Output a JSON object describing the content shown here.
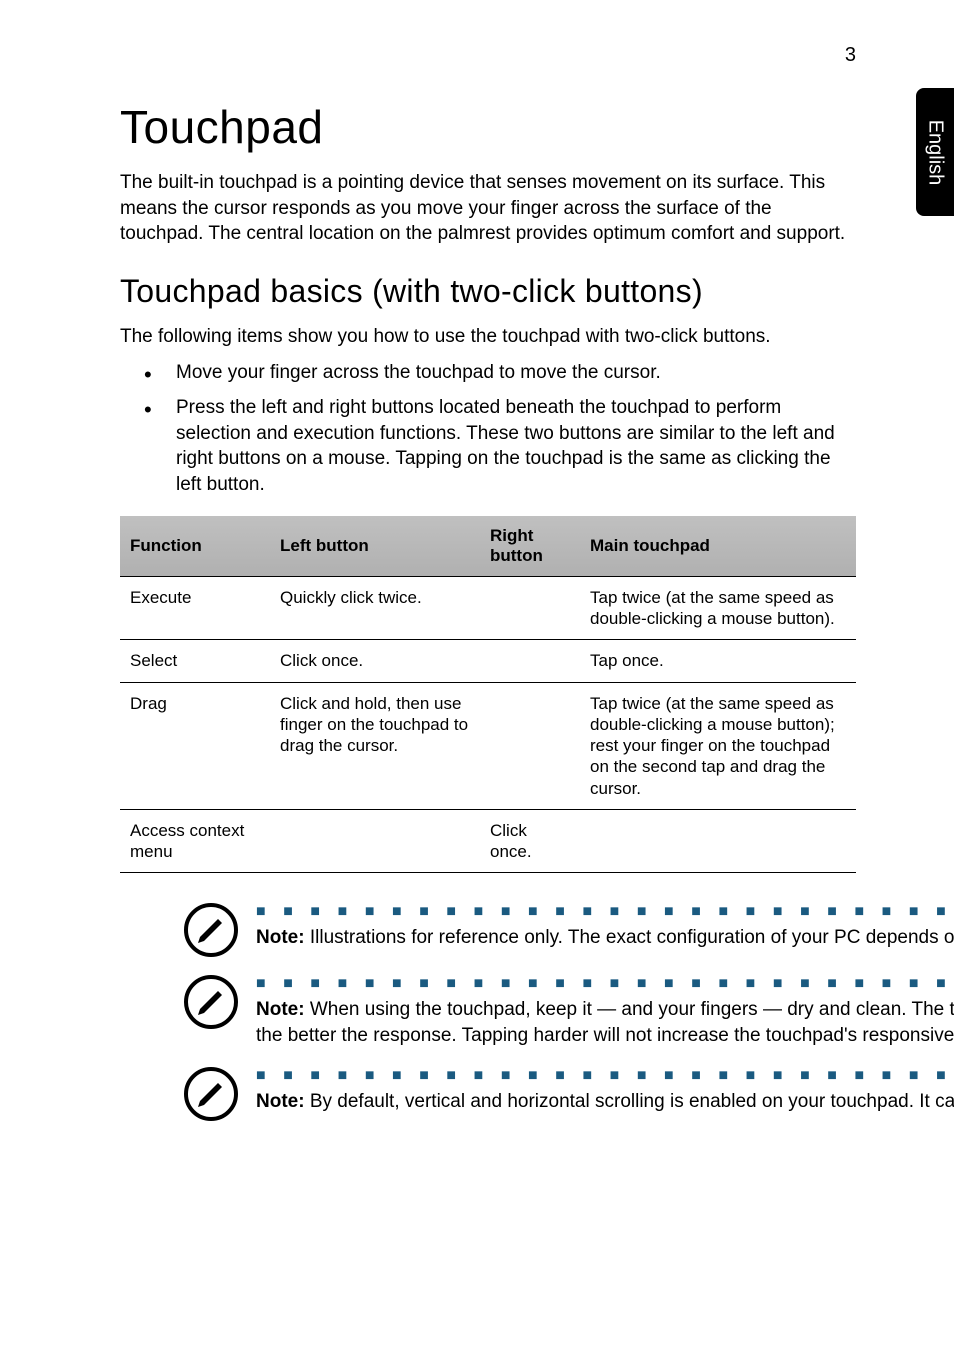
{
  "page_number": "3",
  "side_tab": "English",
  "h1": "Touchpad",
  "intro": "The built-in touchpad is a pointing device that senses movement on its surface. This means the cursor responds as you move your finger across the surface of the touchpad. The central location on the palmrest provides optimum comfort and support.",
  "h2": "Touchpad basics (with two-click buttons)",
  "subintro": "The following items show you how to use the touchpad with two-click buttons.",
  "bullets": [
    "Move your finger across the touchpad to move the cursor.",
    "Press the left and right buttons located beneath the touchpad to perform selection and execution functions. These two buttons are similar to the left and right buttons on a mouse. Tapping on the touchpad is the same as clicking the left button."
  ],
  "table": {
    "headers": {
      "function": "Function",
      "left_button": "Left button",
      "right_button": "Right button",
      "main_touchpad": "Main touchpad"
    },
    "rows": [
      {
        "function": "Execute",
        "left_button": "Quickly click twice.",
        "right_button": "",
        "main_touchpad": "Tap twice (at the same speed as double-clicking a mouse button)."
      },
      {
        "function": "Select",
        "left_button": "Click once.",
        "right_button": "",
        "main_touchpad": "Tap once."
      },
      {
        "function": "Drag",
        "left_button": "Click and hold, then use finger on the touchpad to drag the cursor.",
        "right_button": "",
        "main_touchpad": "Tap twice (at the same speed as double-clicking a mouse button); rest your finger on the touchpad on the second tap and drag the cursor."
      },
      {
        "function": "Access context menu",
        "left_button": "",
        "right_button": "Click once.",
        "main_touchpad": ""
      }
    ]
  },
  "notes": [
    {
      "label": "Note:",
      "text": " Illustrations for reference only. The exact configuration of your PC depends on the model purchased."
    },
    {
      "label": "Note:",
      "text": " When using the touchpad, keep it — and your fingers — dry and clean. The touchpad is sensitive to finger movement; hence, the lighter the touch, the better the response. Tapping harder will not increase the touchpad's responsiveness."
    },
    {
      "label": "Note:",
      "text": " By default, vertical and horizontal scrolling is enabled on your touchpad. It can be disabled under Mouse settings in Windows Control Panel."
    }
  ],
  "dotted_line": "■ ■ ■ ■ ■ ■ ■ ■ ■ ■ ■ ■ ■ ■ ■ ■ ■ ■ ■ ■ ■ ■ ■ ■ ■ ■ ■ ■ ■ ■ ■ ■ ■ ■ ■ ■ ■ ■ ■ ■ ■ ■ ■ ■ ■ ■ ■ ■"
}
